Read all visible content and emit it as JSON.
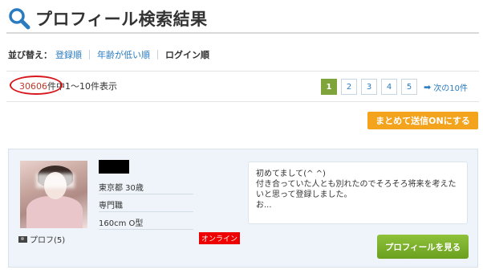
{
  "header": {
    "title": "プロフィール検索結果",
    "icon": "search-icon"
  },
  "sort": {
    "label": "並び替え：",
    "options": [
      "登録順",
      "年齢が低い順",
      "ログイン順"
    ],
    "active": "ログイン順"
  },
  "results": {
    "count": "30606",
    "count_suffix": "件中",
    "range_text": "1〜10件表示"
  },
  "pagination": {
    "pages": [
      "1",
      "2",
      "3",
      "4",
      "5"
    ],
    "current": "1",
    "next_label": "次の10件"
  },
  "actions": {
    "bulk_send_label": "まとめて送信ONにする"
  },
  "profile": {
    "photo_label": "プロフ(5)",
    "location_age": "東京都  30歳",
    "occupation": "専門職",
    "height_blood": "160cm  O型",
    "status": "オンライン",
    "message": "初めてまして(^ ^)\n付き合っていた人とも別れたのでそろそろ将来を考えたいと思って登録しました。\nお...",
    "view_button": "プロフィールを見る"
  },
  "colors": {
    "accent_green": "#7ea43b",
    "button_orange": "#f4a31c",
    "link_blue": "#2a7bbf",
    "online_red": "#ee0000",
    "highlight_circle": "#d7191f"
  }
}
